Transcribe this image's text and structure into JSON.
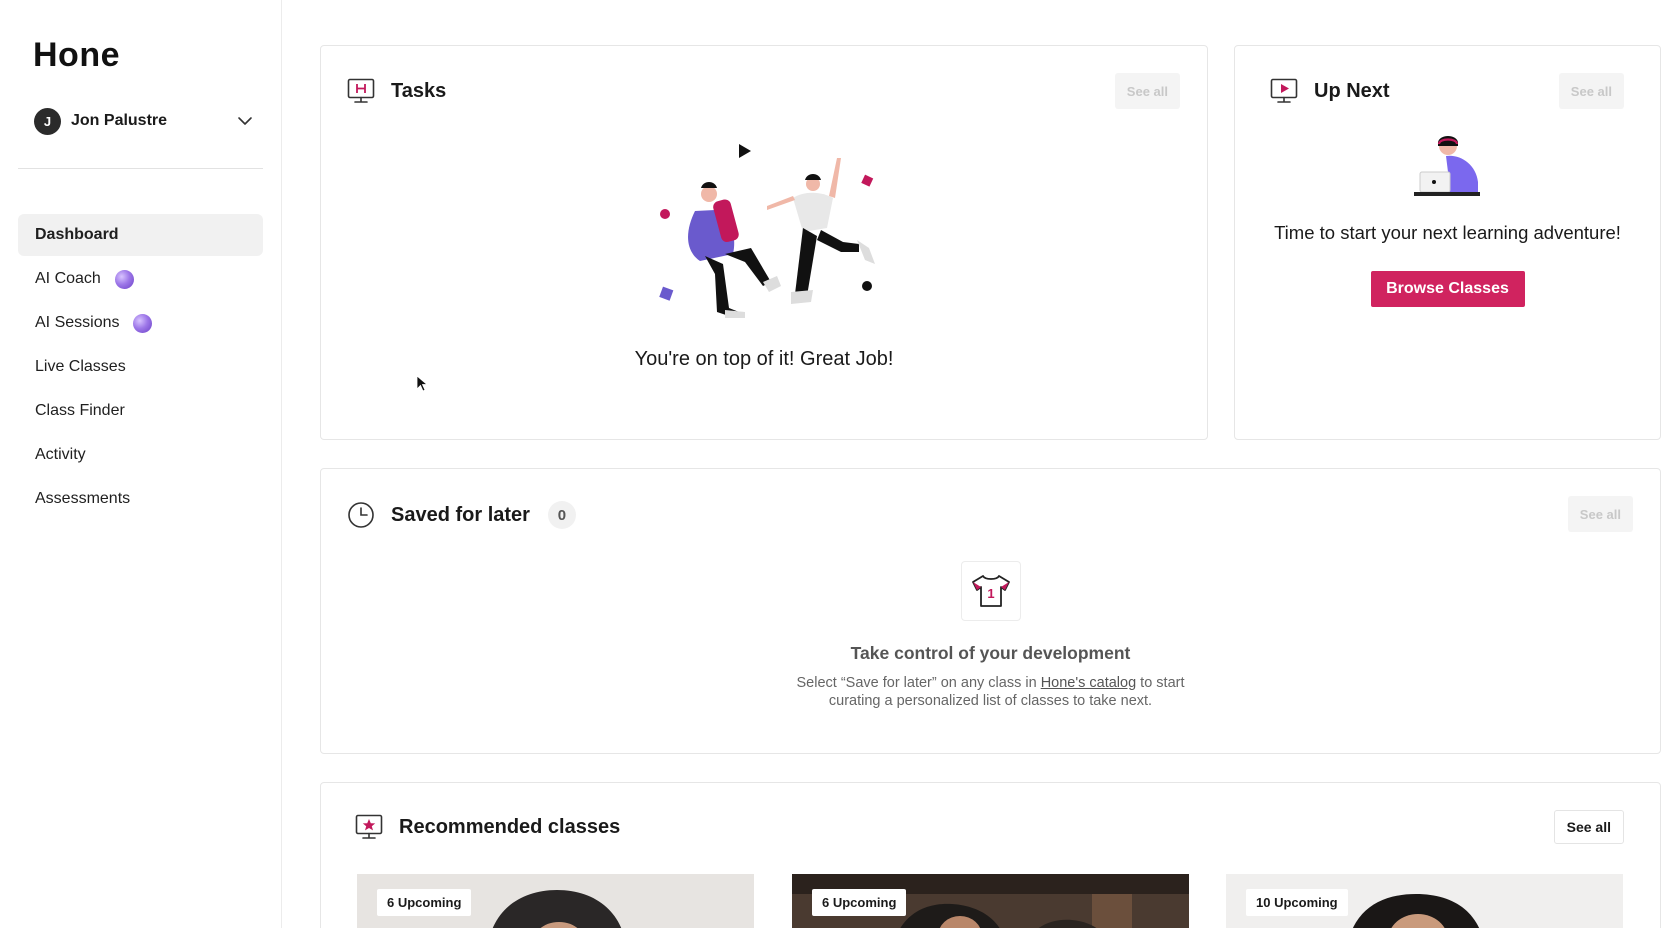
{
  "app": {
    "logo": "Hone"
  },
  "user": {
    "initial": "J",
    "name": "Jon Palustre"
  },
  "sidebar": {
    "items": [
      {
        "label": "Dashboard",
        "active": true
      },
      {
        "label": "AI Coach",
        "ai": true
      },
      {
        "label": "AI Sessions",
        "ai": true
      },
      {
        "label": "Live Classes"
      },
      {
        "label": "Class Finder"
      },
      {
        "label": "Activity"
      },
      {
        "label": "Assessments"
      }
    ]
  },
  "tasks": {
    "title": "Tasks",
    "see_all": "See all",
    "message": "You're on top of it! Great Job!"
  },
  "up_next": {
    "title": "Up Next",
    "see_all": "See all",
    "message": "Time to start your next learning adventure!",
    "button": "Browse Classes"
  },
  "saved": {
    "title": "Saved for later",
    "count": "0",
    "see_all": "See all",
    "icon_number": "1",
    "empty_title": "Take control of your development",
    "desc_before": "Select “Save for later” on any class in ",
    "desc_link": "Hone's catalog",
    "desc_after": " to start curating a personalized list of classes to take next."
  },
  "recommended": {
    "title": "Recommended classes",
    "see_all": "See all",
    "classes": [
      {
        "badge": "6 Upcoming"
      },
      {
        "badge": "6 Upcoming"
      },
      {
        "badge": "10 Upcoming"
      }
    ]
  },
  "colors": {
    "brand": "#d0235f",
    "accent_purple": "#6a5acd",
    "accent_pink": "#c2185b"
  }
}
